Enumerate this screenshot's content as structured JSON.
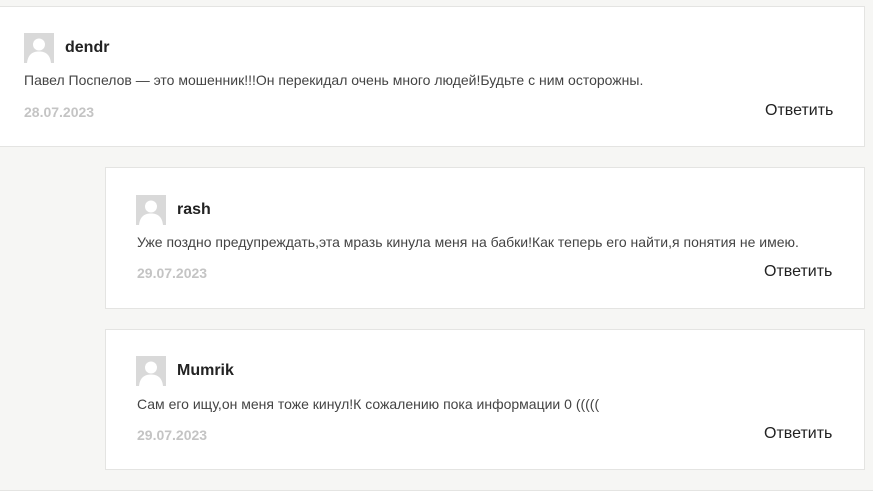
{
  "comments": [
    {
      "author": "dendr",
      "text": "Павел Поспелов — это мошенник!!!Он перекидал очень много людей!Будьте с ним осторожны.",
      "date": "28.07.2023",
      "reply_label": "Ответить"
    },
    {
      "author": "rash",
      "text": "Уже поздно предупреждать,эта мразь кинула меня на бабки!Как теперь его найти,я понятия не имею.",
      "date": "29.07.2023",
      "reply_label": "Ответить"
    },
    {
      "author": "Mumrik",
      "text": "Сам его ищу,он меня тоже кинул!К сожалению пока информации 0 (((((",
      "date": "29.07.2023",
      "reply_label": "Ответить"
    }
  ],
  "icons": {
    "avatar": "user-avatar-placeholder-icon"
  },
  "colors": {
    "background": "#f6f6f4",
    "card": "#ffffff",
    "border": "#e4e4e2",
    "date": "#c4c4c4",
    "avatar": "#d9d9d9"
  }
}
